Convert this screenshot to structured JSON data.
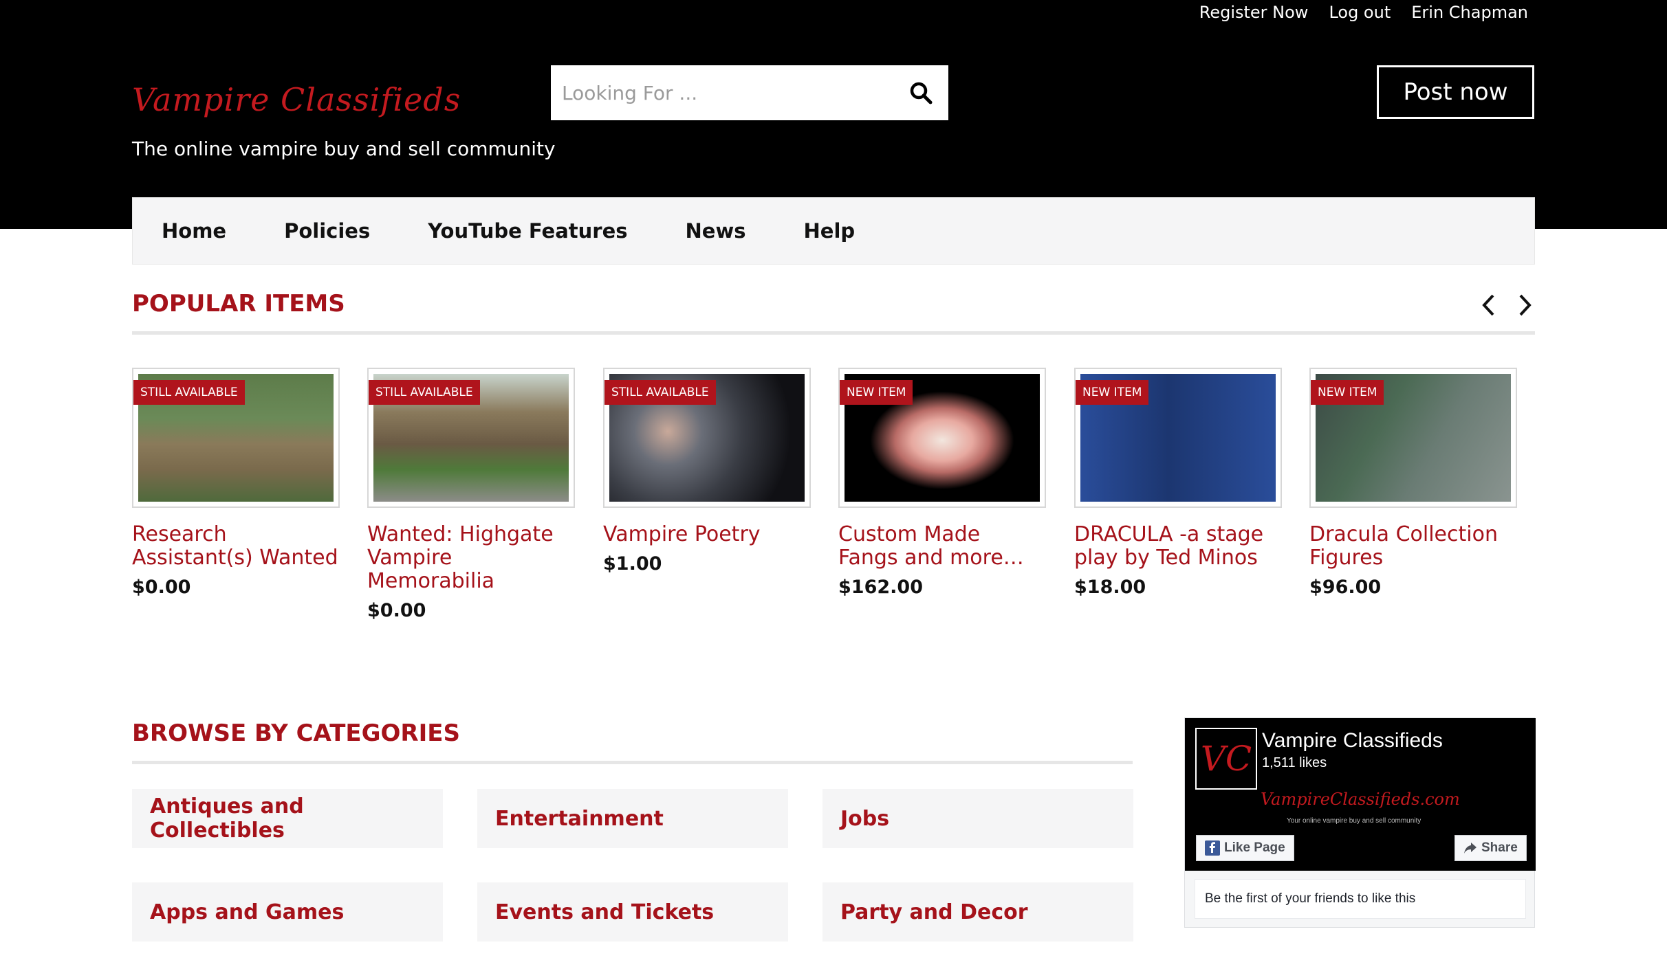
{
  "header": {
    "top_links": [
      "Register Now",
      "Log out",
      "Erin Chapman"
    ],
    "logo": "Vampire Classifieds",
    "tagline": "The online vampire buy and sell community",
    "search_placeholder": "Looking For ...",
    "post_button": "Post now"
  },
  "nav": {
    "items": [
      "Home",
      "Policies",
      "YouTube Features",
      "News",
      "Help"
    ]
  },
  "popular": {
    "heading": "POPULAR ITEMS",
    "items": [
      {
        "badge": "STILL AVAILABLE",
        "title": "Research Assistant(s) Wanted",
        "price": "$0.00"
      },
      {
        "badge": "STILL AVAILABLE",
        "title": "Wanted: Highgate Vampire Memorabilia",
        "price": "$0.00"
      },
      {
        "badge": "STILL AVAILABLE",
        "title": "Vampire Poetry",
        "price": "$1.00"
      },
      {
        "badge": "NEW ITEM",
        "title": "Custom Made Fangs and more…",
        "price": "$162.00"
      },
      {
        "badge": "NEW ITEM",
        "title": "DRACULA -a stage play by Ted Minos",
        "price": "$18.00"
      },
      {
        "badge": "NEW ITEM",
        "title": "Dracula Collection Figures",
        "price": "$96.00"
      }
    ]
  },
  "categories": {
    "heading": "BROWSE BY CATEGORIES",
    "items": [
      "Antiques and Collectibles",
      "Entertainment",
      "Jobs",
      "Apps and Games",
      "Events and Tickets",
      "Party and Decor"
    ]
  },
  "facebook": {
    "page_name": "Vampire Classifieds",
    "likes": "1,511 likes",
    "banner_url": "VampireClassifieds.com",
    "banner_sub": "Your online vampire buy and sell community",
    "logo_text": "VC",
    "like_button": "Like Page",
    "share_button": "Share",
    "friends_text": "Be the first of your friends to like this"
  },
  "colors": {
    "accent": "#a5121a",
    "badge": "#b0141c",
    "header_bg": "#000000"
  }
}
